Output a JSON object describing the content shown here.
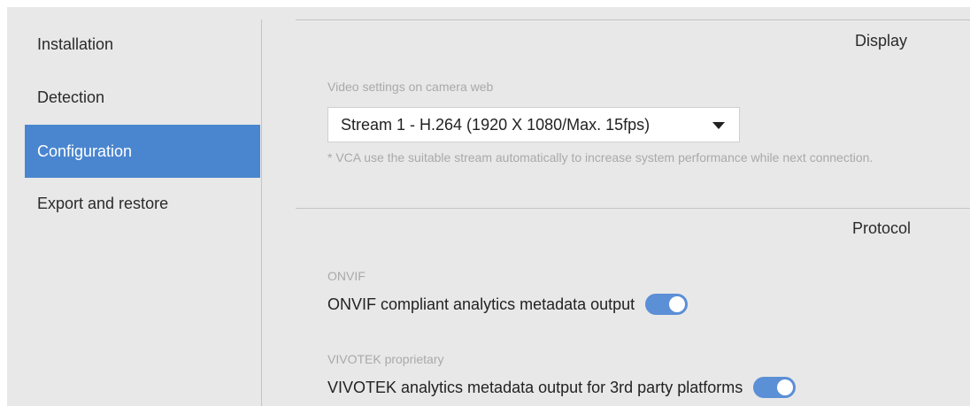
{
  "sidebar": {
    "items": [
      {
        "label": "Installation",
        "active": false
      },
      {
        "label": "Detection",
        "active": false
      },
      {
        "label": "Configuration",
        "active": true
      },
      {
        "label": "Export and restore",
        "active": false
      }
    ]
  },
  "display": {
    "title": "Display",
    "video_label": "Video settings on camera web",
    "stream_selected": "Stream 1 - H.264 (1920 X 1080/Max. 15fps)",
    "note": "* VCA use the suitable stream automatically to increase system performance while next connection."
  },
  "protocol": {
    "title": "Protocol",
    "onvif_heading": "ONVIF",
    "onvif_label": "ONVIF compliant analytics metadata output",
    "onvif_enabled": true,
    "vivotek_heading": "VIVOTEK proprietary",
    "vivotek_label": "VIVOTEK analytics metadata output for 3rd party platforms",
    "vivotek_enabled": true
  },
  "colors": {
    "accent": "#4a86cf",
    "toggle_on": "#5b8fd6",
    "panel_bg": "#e8e8e8"
  }
}
